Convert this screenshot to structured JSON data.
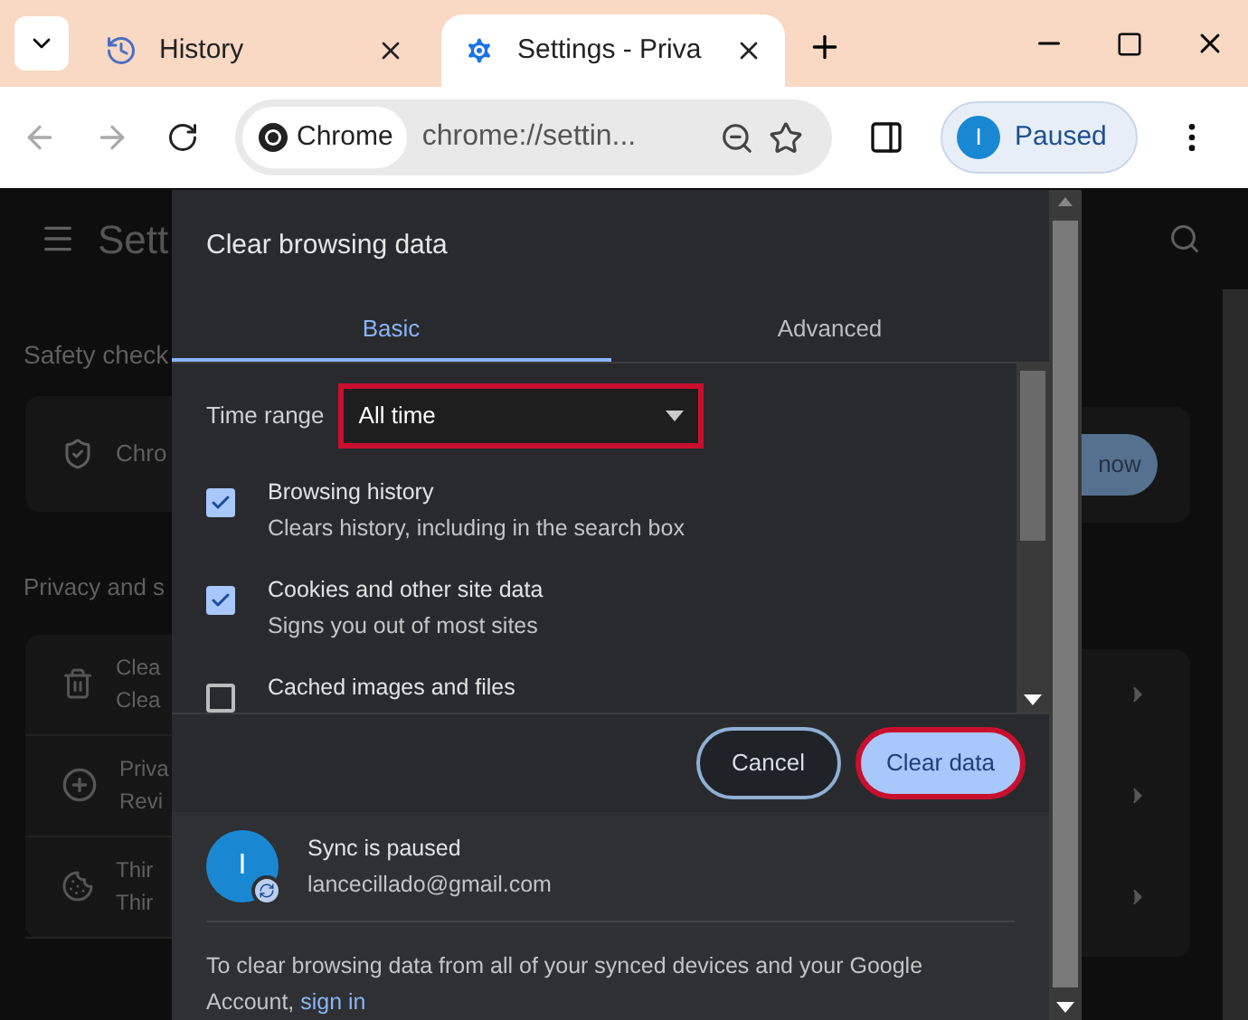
{
  "browser": {
    "tabs": [
      {
        "kind": "history",
        "label": "History",
        "selected": false
      },
      {
        "kind": "settings",
        "label": "Settings - Priva",
        "selected": true
      }
    ],
    "site_chip": "Chrome",
    "address": "chrome://settin...",
    "profile": {
      "initial": "I",
      "label": "Paused"
    }
  },
  "settings_page": {
    "title": "Sett",
    "safety_check": {
      "heading": "Safety check",
      "item": "Chro",
      "button": "now"
    },
    "privacy": {
      "heading": "Privacy and s",
      "rows": [
        {
          "kind": "trash",
          "title": "Clea",
          "subtitle": "Clea"
        },
        {
          "kind": "plus",
          "title": "Priva",
          "subtitle": "Revi"
        },
        {
          "kind": "cookie",
          "title": "Thir",
          "subtitle": "Thir"
        }
      ]
    }
  },
  "dialog": {
    "title": "Clear browsing data",
    "tabs": [
      {
        "label": "Basic",
        "selected": true
      },
      {
        "label": "Advanced",
        "selected": false
      }
    ],
    "time_range": {
      "label": "Time range",
      "value": "All time"
    },
    "options": [
      {
        "title": "Browsing history",
        "subtitle": "Clears history, including in the search box",
        "checked": true
      },
      {
        "title": "Cookies and other site data",
        "subtitle": "Signs you out of most sites",
        "checked": true
      },
      {
        "title": "Cached images and files",
        "checked": false
      }
    ],
    "buttons": {
      "cancel": "Cancel",
      "confirm": "Clear data"
    },
    "sync": {
      "initial": "I",
      "status": "Sync is paused",
      "email": "lancecillado@gmail.com"
    },
    "footer": {
      "text": "To clear browsing data from all of your synced devices and your Google",
      "text_2": "Account,",
      "link": "sign in"
    }
  }
}
